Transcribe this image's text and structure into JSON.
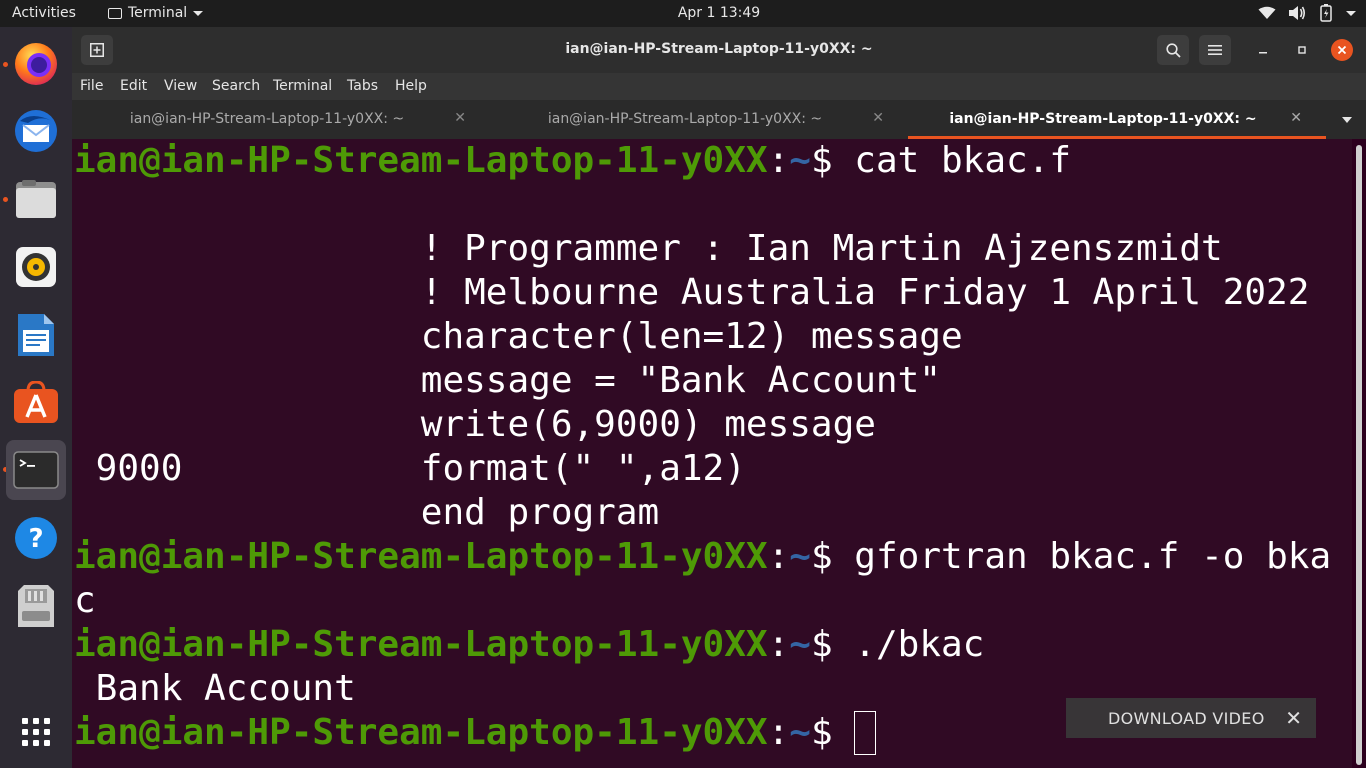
{
  "topbar": {
    "activities": "Activities",
    "app_name": "Terminal",
    "clock": "Apr 1  13:49"
  },
  "window": {
    "title": "ian@ian-HP-Stream-Laptop-11-y0XX: ~"
  },
  "menubar": {
    "items": [
      "File",
      "Edit",
      "View",
      "Search",
      "Terminal",
      "Tabs",
      "Help"
    ]
  },
  "tabs": [
    {
      "label": "ian@ian-HP-Stream-Laptop-11-y0XX: ~",
      "active": false
    },
    {
      "label": "ian@ian-HP-Stream-Laptop-11-y0XX: ~",
      "active": false
    },
    {
      "label": "ian@ian-HP-Stream-Laptop-11-y0XX: ~",
      "active": true
    }
  ],
  "prompt": {
    "user": "ian@ian-HP-Stream-Laptop-11-y0XX",
    "path": "~",
    "symbol": "$"
  },
  "terminal": {
    "cmd1": " cat bkac.f",
    "src1": "                ! Programmer : Ian Martin Ajzenszmidt",
    "src2": "                ! Melbourne Australia Friday 1 April 2022",
    "src3": "                character(len=12) message",
    "src4": "                message = \"Bank Account\"",
    "src5": "                write(6,9000) message",
    "src6": " 9000           format(\" \",a12)",
    "src7": "                end program",
    "cmd2": " gfortran bkac.f -o bka",
    "cmd2_wrap": "c",
    "cmd3": " ./bkac",
    "output1": " Bank Account"
  },
  "download": {
    "label": "DOWNLOAD VIDEO",
    "close": "✕"
  },
  "colors": {
    "accent": "#e95420",
    "terminal_bg": "#300a24",
    "prompt_user": "#4e9a06",
    "prompt_path": "#3465a4"
  },
  "dock": {
    "icons": [
      "firefox-icon",
      "thunderbird-icon",
      "files-icon",
      "rhythmbox-icon",
      "libreoffice-writer-icon",
      "ubuntu-software-icon",
      "terminal-icon",
      "help-icon",
      "usb-drive-icon",
      "show-apps-icon"
    ]
  }
}
